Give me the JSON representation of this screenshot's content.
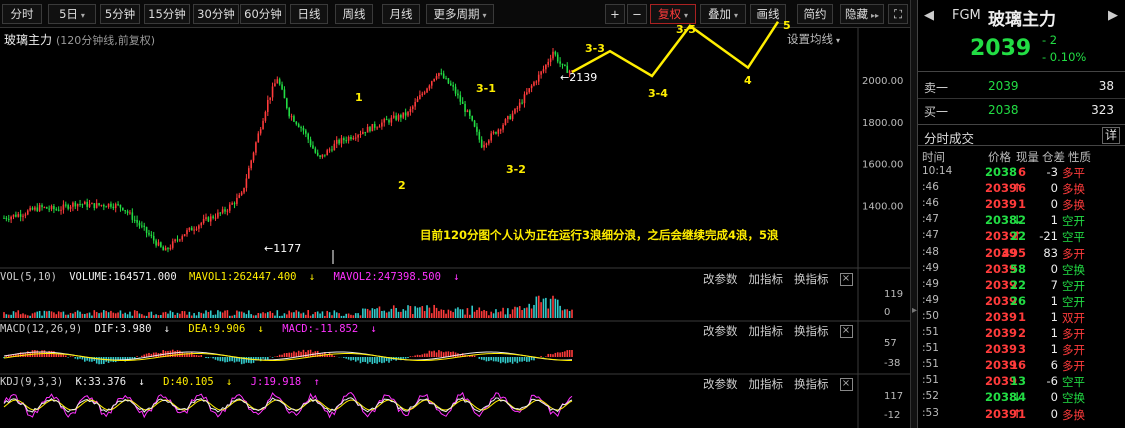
{
  "toolbar": {
    "periods": [
      "分时",
      "5日",
      "5分钟",
      "15分钟",
      "30分钟",
      "60分钟",
      "日线",
      "周线",
      "月线",
      "更多周期"
    ],
    "tools": [
      "+",
      "−",
      "复权",
      "叠加",
      "画线",
      "简约",
      "隐藏"
    ],
    "more_arrow": "▸▸"
  },
  "main": {
    "title": "玻璃主力",
    "subtitle": "(120分钟线,前复权)",
    "ma_setting": "设置均线",
    "y_axis": [
      "2000.00",
      "1800.00",
      "1600.00",
      "1400.00"
    ],
    "wave_labels": [
      "1",
      "2",
      "3-1",
      "3-2",
      "3-3",
      "3-4",
      "3-5",
      "4",
      "5"
    ],
    "low_mark": "1177",
    "high_mark": "2139",
    "annotation": "目前120分图个人认为正在运行3浪细分浪，之后会继续完成4浪，5浪"
  },
  "chart_data": {
    "type": "candlestick",
    "title": "玻璃主力",
    "ylabel": "",
    "ylim": [
      1200,
      2250
    ],
    "y_ticks": [
      1400,
      1600,
      1800,
      2000
    ],
    "low": 1177,
    "high": 2139,
    "last": 2039,
    "wave_points": [
      {
        "label": "1",
        "price": 2010
      },
      {
        "label": "2",
        "price": 1620
      },
      {
        "label": "3-1",
        "price": 2040
      },
      {
        "label": "3-2",
        "price": 1690
      },
      {
        "label": "3-3",
        "price": 2139
      },
      {
        "label": "3-4",
        "price": 2020
      },
      {
        "label": "3-5",
        "price": 2260
      },
      {
        "label": "4",
        "price": 2060
      },
      {
        "label": "5",
        "price": 2280
      }
    ]
  },
  "vol": {
    "name": "VOL(5,10)",
    "volume": "VOLUME:164571.000",
    "mavol1": "MAVOL1:262447.400",
    "mavol2": "MAVOL2:247398.500",
    "y_axis": [
      "119",
      "0"
    ]
  },
  "macd": {
    "name": "MACD(12,26,9)",
    "dif": "DIF:3.980",
    "dea": "DEA:9.906",
    "macd": "MACD:-11.852",
    "y_axis": [
      "57",
      "-38"
    ]
  },
  "kdj": {
    "name": "KDJ(9,3,3)",
    "k": "K:33.376",
    "d": "D:40.105",
    "j": "J:19.918",
    "y_axis": [
      "117",
      "-12"
    ]
  },
  "sub_buttons": [
    "改参数",
    "加指标",
    "换指标"
  ],
  "close_glyph": "×",
  "quote": {
    "symbol": "FGM",
    "name": "玻璃主力",
    "price": "2039",
    "change": "- 2",
    "pct": "- 0.10%",
    "ask_label": "卖一",
    "ask_price": "2039",
    "ask_vol": "38",
    "bid_label": "买一",
    "bid_price": "2038",
    "bid_vol": "323"
  },
  "trades": {
    "title": "分时成交",
    "detail": "详",
    "columns": [
      "时间",
      "价格",
      "现量",
      "仓差",
      "性质"
    ],
    "rows": [
      {
        "time": "10:14",
        "price": "2038",
        "arrow": "",
        "vol": "6",
        "oi": "-3",
        "nature": "多平"
      },
      {
        "time": ":46",
        "price": "2039",
        "arrow": "↑",
        "vol": "6",
        "oi": "0",
        "nature": "多换"
      },
      {
        "time": ":46",
        "price": "2039",
        "arrow": "",
        "vol": "1",
        "oi": "0",
        "nature": "多换"
      },
      {
        "time": ":47",
        "price": "2038",
        "arrow": "↓",
        "vol": "2",
        "oi": "1",
        "nature": "空开"
      },
      {
        "time": ":47",
        "price": "2039",
        "arrow": "↑",
        "vol": "22",
        "oi": "-21",
        "nature": "空平"
      },
      {
        "time": ":48",
        "price": "2039",
        "arrow": "",
        "vol": "495",
        "oi": "83",
        "nature": "多开"
      },
      {
        "time": ":49",
        "price": "2039",
        "arrow": "",
        "vol": "58",
        "oi": "0",
        "nature": "空换"
      },
      {
        "time": ":49",
        "price": "2039",
        "arrow": "",
        "vol": "22",
        "oi": "7",
        "nature": "空开"
      },
      {
        "time": ":49",
        "price": "2039",
        "arrow": "",
        "vol": "26",
        "oi": "1",
        "nature": "空开"
      },
      {
        "time": ":50",
        "price": "2039",
        "arrow": "",
        "vol": "1",
        "oi": "1",
        "nature": "双开"
      },
      {
        "time": ":51",
        "price": "2039",
        "arrow": "",
        "vol": "2",
        "oi": "1",
        "nature": "多开"
      },
      {
        "time": ":51",
        "price": "2039",
        "arrow": "",
        "vol": "3",
        "oi": "1",
        "nature": "多开"
      },
      {
        "time": ":51",
        "price": "2039",
        "arrow": "",
        "vol": "16",
        "oi": "6",
        "nature": "多开"
      },
      {
        "time": ":51",
        "price": "2039",
        "arrow": "",
        "vol": "13",
        "oi": "-6",
        "nature": "空平"
      },
      {
        "time": ":52",
        "price": "2038",
        "arrow": "↓",
        "vol": "4",
        "oi": "0",
        "nature": "空换"
      },
      {
        "time": ":53",
        "price": "2039",
        "arrow": "↑",
        "vol": "1",
        "oi": "0",
        "nature": "多换"
      }
    ]
  },
  "colors": {
    "up": "#ff3b3b",
    "down": "#22dd44",
    "wave": "#ffee00",
    "kdj_j": "#ff33ff"
  }
}
